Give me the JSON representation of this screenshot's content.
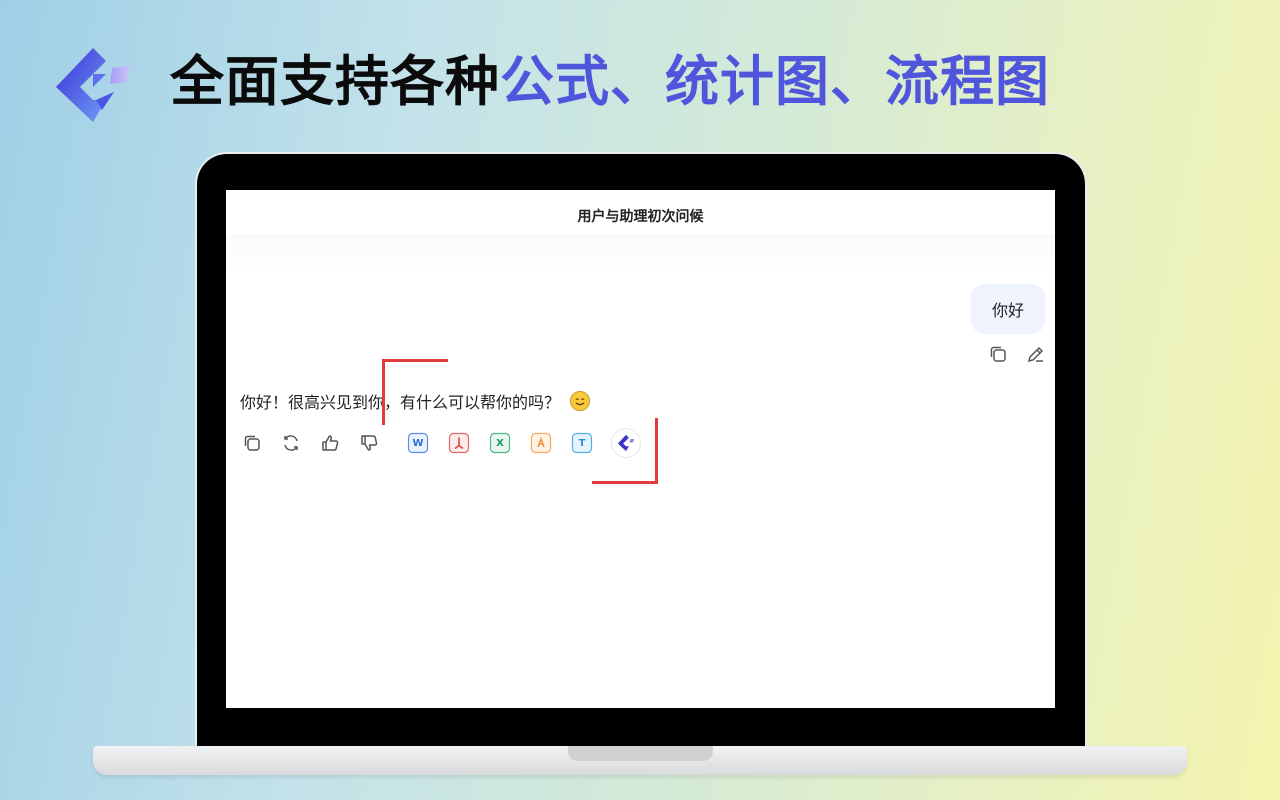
{
  "banner": {
    "headline_black": "全面支持各种",
    "headline_blue": "公式、统计图、流程图",
    "accent_color": "#4f56dc"
  },
  "conversation": {
    "title": "用户与助理初次问候",
    "user_message": "你好",
    "assistant_message": "你好！很高兴见到你，有什么可以帮你的吗？",
    "assistant_emoji": "smiling-face-icon"
  },
  "user_actions": [
    "copy-icon",
    "edit-icon"
  ],
  "assistant_actions": [
    "copy-icon",
    "regenerate-icon",
    "thumbs-up-icon",
    "thumbs-down-icon"
  ],
  "export_formats": [
    {
      "icon": "word-file-icon",
      "glyph": "W",
      "color": "#2b6cd8"
    },
    {
      "icon": "pdf-file-icon",
      "glyph": "⅄",
      "color": "#e0443e"
    },
    {
      "icon": "excel-file-icon",
      "glyph": "X",
      "color": "#1e9a5c"
    },
    {
      "icon": "ppt-file-icon",
      "glyph": "ꞛ",
      "color": "#f2913d"
    },
    {
      "icon": "text-file-icon",
      "glyph": "T",
      "color": "#2891d6"
    }
  ],
  "brand_logo": "app-logo-icon"
}
